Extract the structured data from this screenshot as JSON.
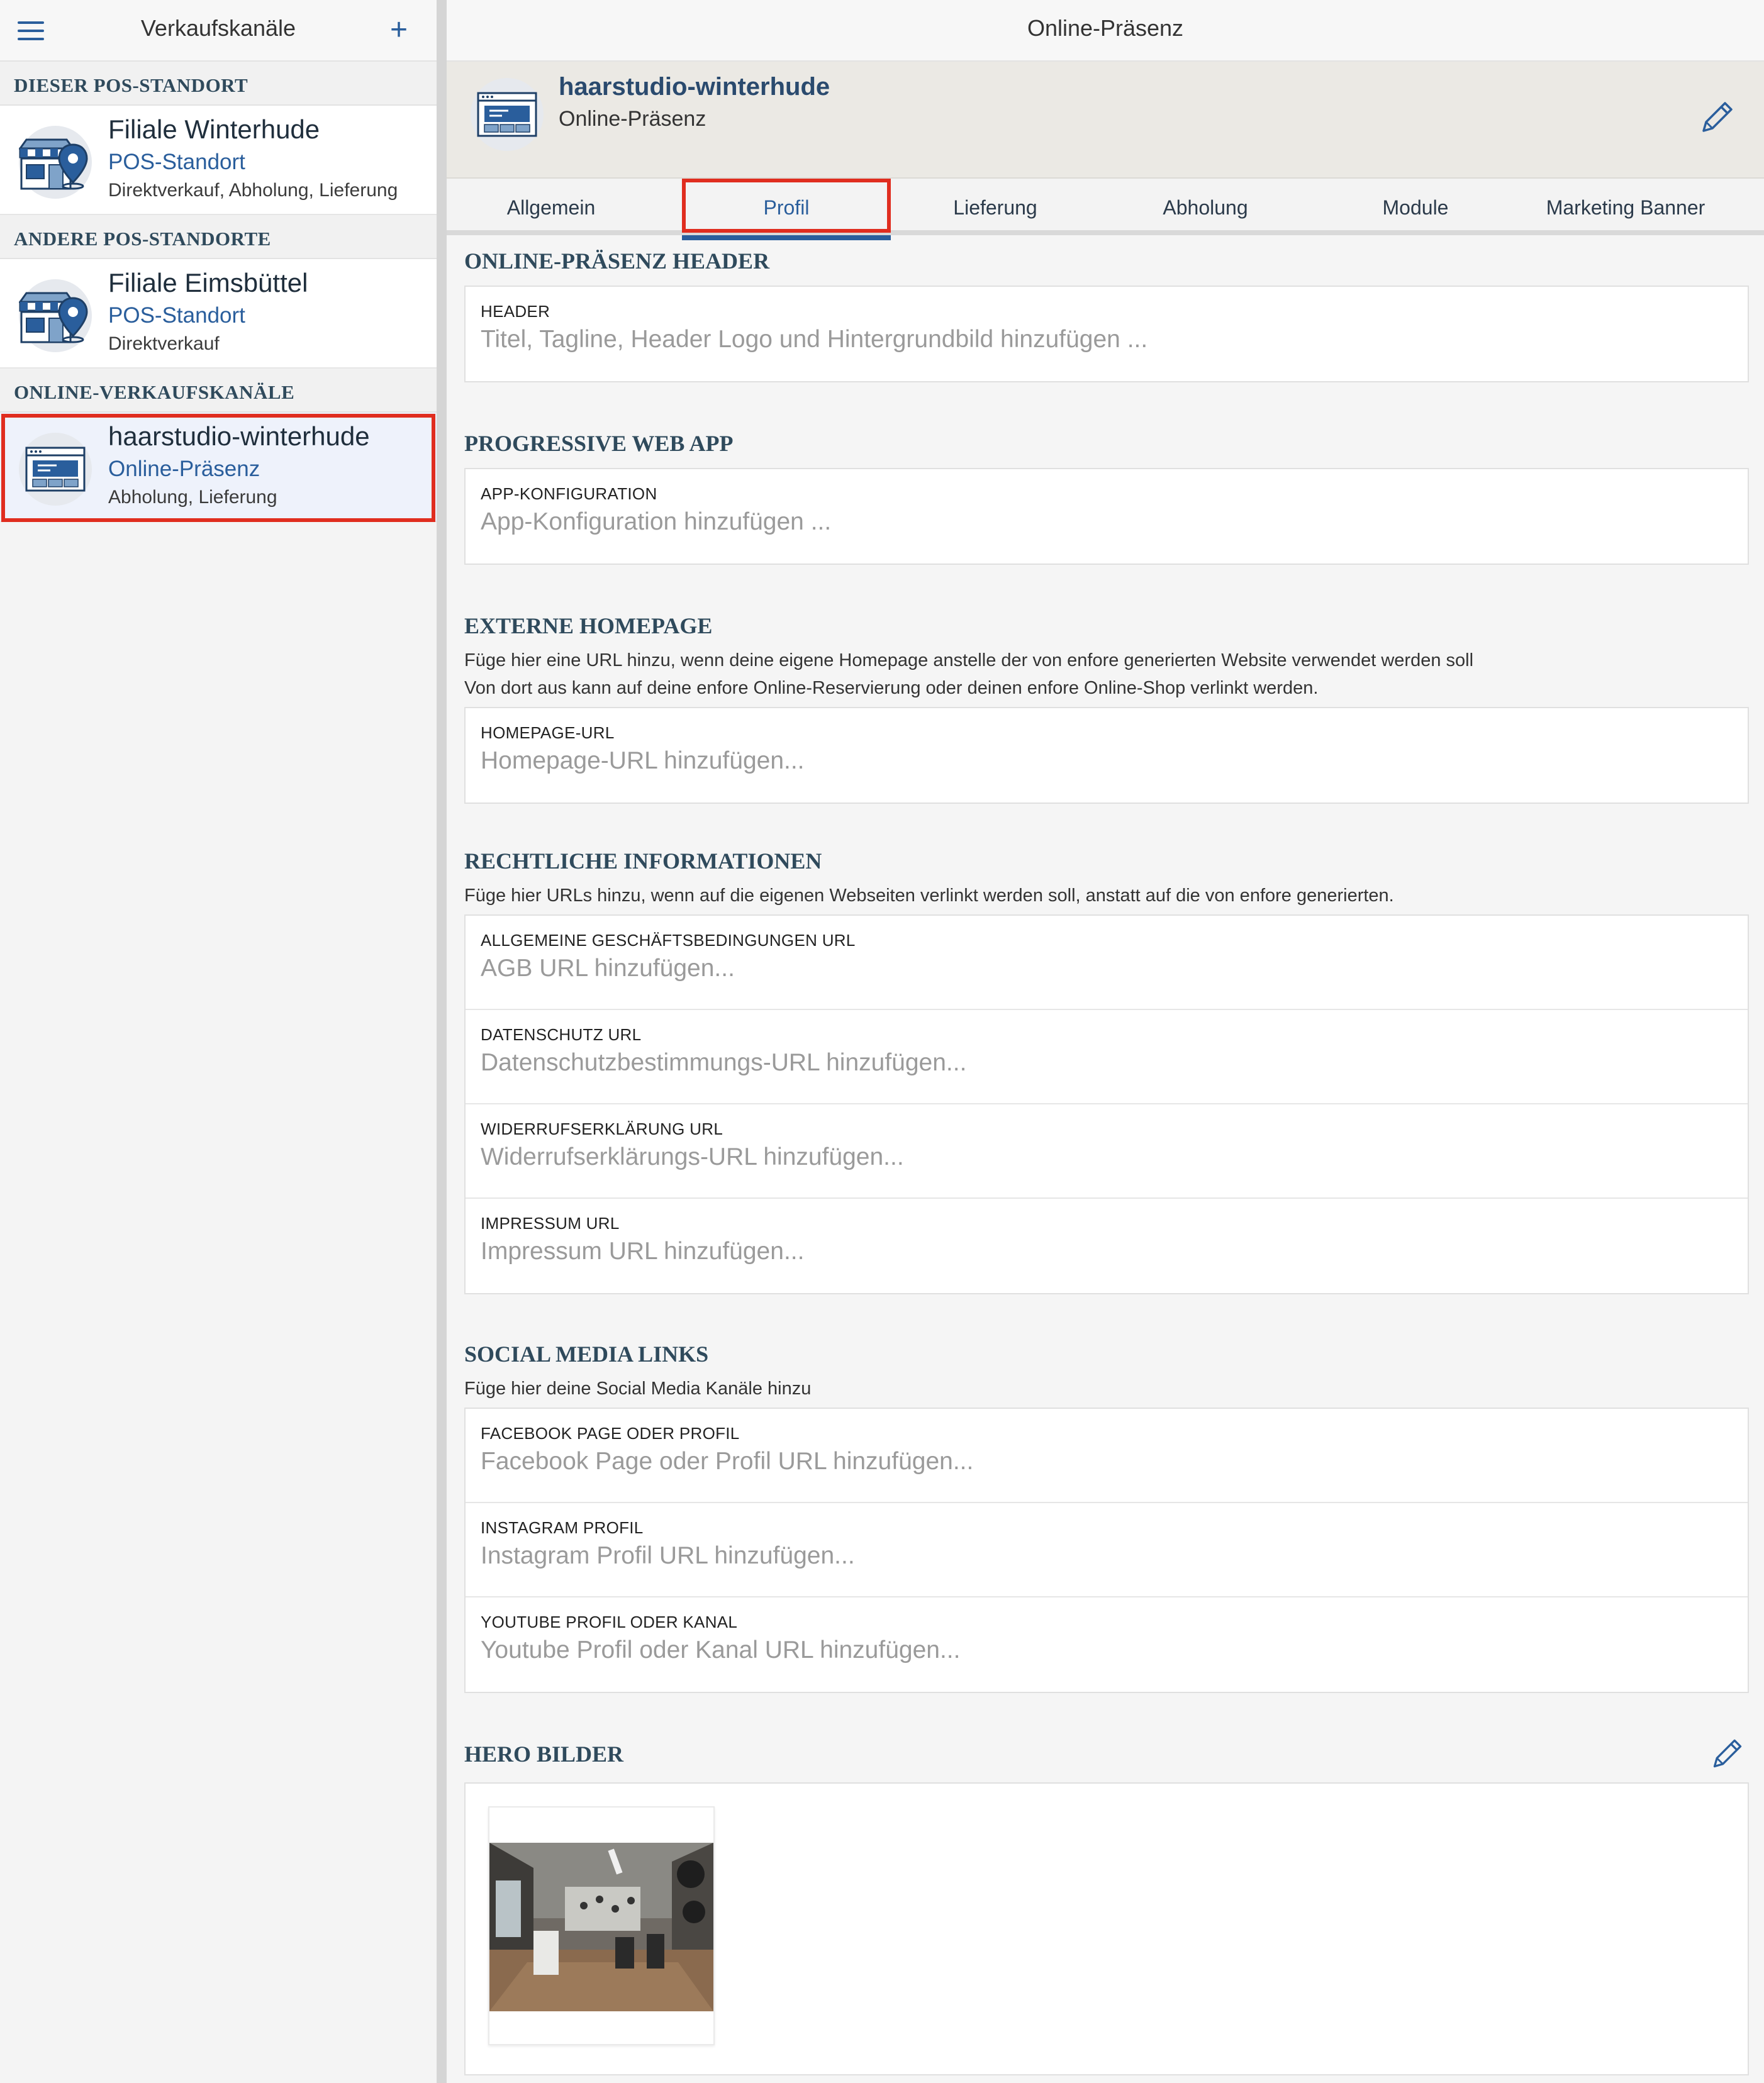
{
  "sidebar": {
    "title": "Verkaufskanäle",
    "sections": {
      "this_pos": "DIESER POS-STANDORT",
      "other_pos": "ANDERE POS-STANDORTE",
      "online": "ONLINE-VERKAUFSKANÄLE"
    },
    "channels": [
      {
        "name": "Filiale Winterhude",
        "type": "POS-Standort",
        "desc": "Direktverkauf, Abholung, Lieferung",
        "icon": "store-location-icon"
      },
      {
        "name": "Filiale Eimsbüttel",
        "type": "POS-Standort",
        "desc": "Direktverkauf",
        "icon": "store-location-icon"
      },
      {
        "name": "haarstudio-winterhude",
        "type": "Online-Präsenz",
        "desc": "Abholung, Lieferung",
        "icon": "website-icon"
      }
    ]
  },
  "main": {
    "title": "Online-Präsenz",
    "header": {
      "title": "haarstudio-winterhude",
      "subtitle": "Online-Präsenz"
    },
    "tabs": [
      "Allgemein",
      "Profil",
      "Lieferung",
      "Abholung",
      "Module",
      "Marketing Banner"
    ],
    "active_tab": "Profil",
    "sections": {
      "header": {
        "title": "ONLINE-PRÄSENZ HEADER",
        "fields": [
          {
            "label": "HEADER",
            "placeholder": "Titel, Tagline, Header Logo und Hintergrundbild hinzufügen ..."
          }
        ]
      },
      "pwa": {
        "title": "PROGRESSIVE WEB APP",
        "fields": [
          {
            "label": "APP-KONFIGURATION",
            "placeholder": "App-Konfiguration hinzufügen ..."
          }
        ]
      },
      "homepage": {
        "title": "EXTERNE HOMEPAGE",
        "desc1": "Füge hier eine URL hinzu, wenn deine eigene Homepage anstelle der von enfore generierten Website verwendet werden soll",
        "desc2": "Von dort aus kann auf deine enfore Online-Reservierung oder deinen enfore Online-Shop verlinkt werden.",
        "fields": [
          {
            "label": "HOMEPAGE-URL",
            "placeholder": "Homepage-URL hinzufügen..."
          }
        ]
      },
      "legal": {
        "title": "RECHTLICHE INFORMATIONEN",
        "desc": "Füge hier URLs hinzu, wenn auf die eigenen Webseiten verlinkt werden soll, anstatt auf die von enfore generierten.",
        "fields": [
          {
            "label": "ALLGEMEINE GESCHÄFTSBEDINGUNGEN URL",
            "placeholder": "AGB URL hinzufügen..."
          },
          {
            "label": "DATENSCHUTZ URL",
            "placeholder": "Datenschutzbestimmungs-URL hinzufügen..."
          },
          {
            "label": "WIDERRUFSERKLÄRUNG URL",
            "placeholder": "Widerrufserklärungs-URL hinzufügen..."
          },
          {
            "label": "IMPRESSUM URL",
            "placeholder": "Impressum URL hinzufügen..."
          }
        ]
      },
      "social": {
        "title": "SOCIAL MEDIA LINKS",
        "desc": "Füge hier deine Social Media Kanäle hinzu",
        "fields": [
          {
            "label": "FACEBOOK PAGE ODER PROFIL",
            "placeholder": "Facebook Page oder Profil URL hinzufügen..."
          },
          {
            "label": "INSTAGRAM PROFIL",
            "placeholder": "Instagram Profil URL hinzufügen..."
          },
          {
            "label": "YOUTUBE PROFIL ODER KANAL",
            "placeholder": "Youtube Profil oder Kanal URL hinzufügen..."
          }
        ]
      },
      "hero": {
        "title": "HERO BILDER"
      }
    }
  },
  "colors": {
    "accent": "#2a5e9c",
    "highlight": "#e02d1f",
    "section_title": "#2f4a5c"
  }
}
